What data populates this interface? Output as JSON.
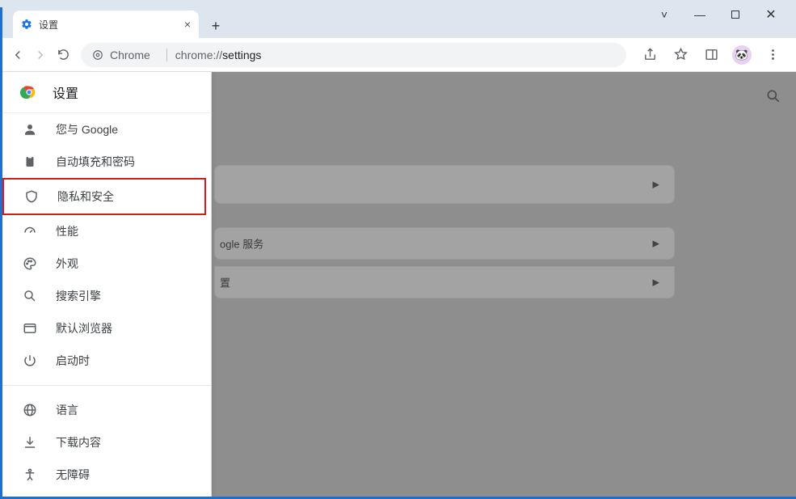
{
  "window": {
    "tab_title": "设置",
    "url_prefix": "Chrome",
    "url_main": "chrome://",
    "url_suffix": "settings"
  },
  "sidebar": {
    "title": "设置",
    "items": [
      {
        "label": "您与 Google",
        "icon": "person"
      },
      {
        "label": "自动填充和密码",
        "icon": "clipboard"
      },
      {
        "label": "隐私和安全",
        "icon": "shield"
      },
      {
        "label": "性能",
        "icon": "speedometer"
      },
      {
        "label": "外观",
        "icon": "palette"
      },
      {
        "label": "搜索引擎",
        "icon": "search"
      },
      {
        "label": "默认浏览器",
        "icon": "browser"
      },
      {
        "label": "启动时",
        "icon": "power"
      }
    ],
    "items2": [
      {
        "label": "语言",
        "icon": "globe"
      },
      {
        "label": "下载内容",
        "icon": "download"
      },
      {
        "label": "无障碍",
        "icon": "accessibility"
      }
    ]
  },
  "content_cards": {
    "c2": "ogle 服务",
    "c3_fragment": "置"
  }
}
